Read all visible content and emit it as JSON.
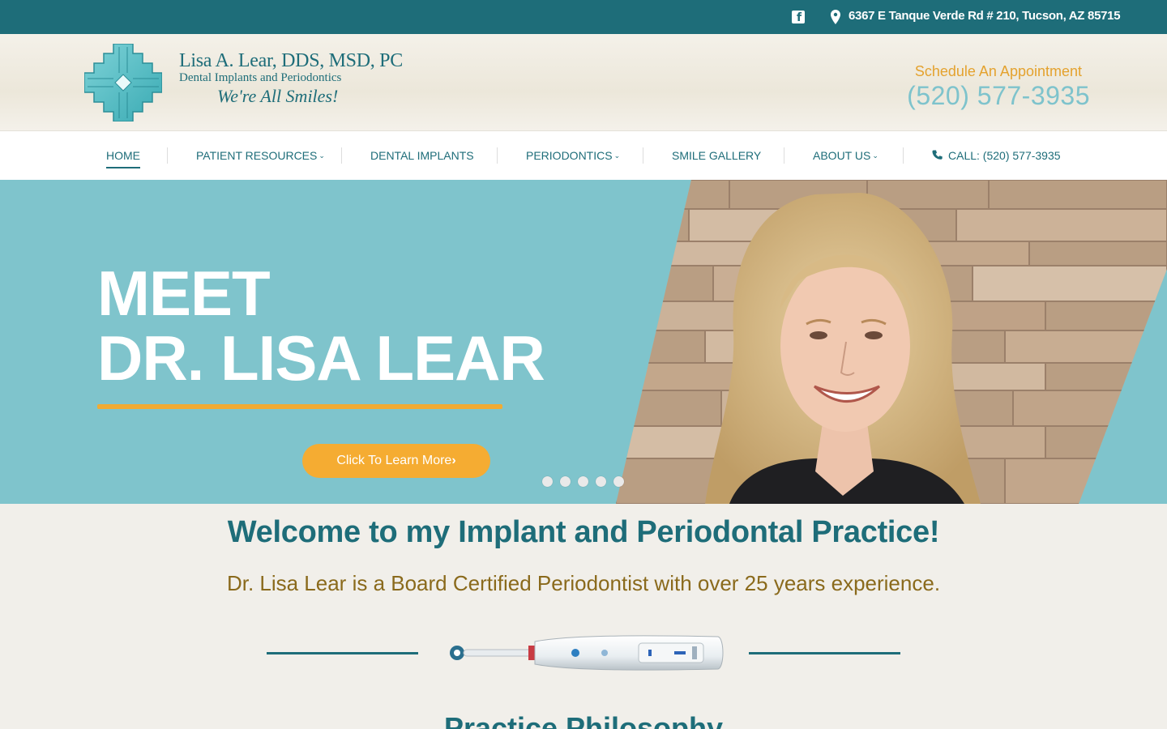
{
  "topbar": {
    "facebook_icon": "facebook-icon",
    "pin_icon": "map-pin-icon",
    "address": "6367 E Tanque Verde Rd # 210, Tucson, AZ 85715"
  },
  "header": {
    "logo": {
      "name": "Lisa A. Lear, DDS, MSD, PC",
      "subtitle": "Dental Implants and Periodontics",
      "tagline": "We're All Smiles!"
    },
    "schedule_label": "Schedule An Appointment",
    "phone": "(520) 577-3935"
  },
  "nav": {
    "items": [
      {
        "label": "HOME",
        "active": true
      },
      {
        "label": "PATIENT RESOURCES",
        "dropdown": true
      },
      {
        "label": "DENTAL IMPLANTS"
      },
      {
        "label": "PERIODONTICS",
        "dropdown": true
      },
      {
        "label": "SMILE GALLERY"
      },
      {
        "label": "ABOUT US",
        "dropdown": true
      },
      {
        "label": "CALL: (520) 577-3935",
        "icon": "phone-icon"
      }
    ]
  },
  "hero": {
    "title_line1": "MEET",
    "title_line2": "DR. LISA LEAR",
    "cta_label": "Click To Learn More",
    "slides_count": 5,
    "active_slide": 1
  },
  "welcome": {
    "title": "Welcome to my Implant and Periodontal Practice!",
    "subtitle": "Dr. Lisa Lear is a Board Certified Periodontist with over 25 years experience."
  },
  "next_section": {
    "title": "Practice Philosophy"
  },
  "colors": {
    "brand_teal": "#1e6d79",
    "hero_bg": "#7fc4cc",
    "accent_orange": "#f5ac32",
    "subtitle_gold": "#8a6a1c"
  }
}
